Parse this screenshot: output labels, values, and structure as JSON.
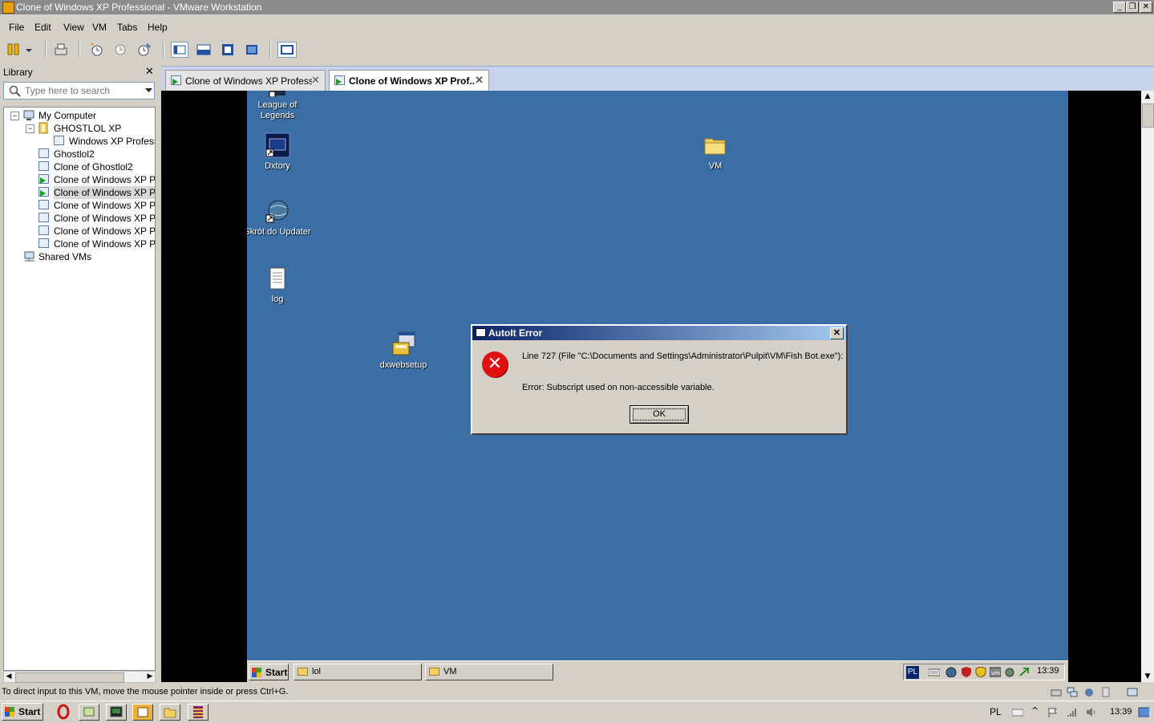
{
  "window": {
    "title": "Clone of Windows XP Professional - VMware Workstation"
  },
  "menu": [
    "File",
    "Edit",
    "View",
    "VM",
    "Tabs",
    "Help"
  ],
  "library": {
    "title": "Library",
    "search_placeholder": "Type here to search",
    "tree": [
      {
        "label": "My Computer"
      },
      {
        "label": "GHOSTLOL XP"
      },
      {
        "label": "Windows XP Professior"
      },
      {
        "label": "Ghostlol2"
      },
      {
        "label": "Clone of Ghostlol2"
      },
      {
        "label": "Clone of Windows XP Profe",
        "running": true
      },
      {
        "label": "Clone of Windows XP Profe",
        "running": true,
        "selected": true
      },
      {
        "label": "Clone of Windows XP Profe"
      },
      {
        "label": "Clone of Windows XP Profe"
      },
      {
        "label": "Clone of Windows XP Profe"
      },
      {
        "label": "Clone of Windows XP Profe"
      },
      {
        "label": "Shared VMs"
      }
    ]
  },
  "tabs": [
    {
      "label": "Clone of Windows XP Professi...",
      "active": false
    },
    {
      "label": "Clone of Windows XP Prof...",
      "active": true
    }
  ],
  "guest": {
    "desktop_icons": [
      {
        "label": "League of Legends"
      },
      {
        "label": "Dxtory"
      },
      {
        "label": "Skrót do Updater"
      },
      {
        "label": "log"
      },
      {
        "label": "dxwebsetup"
      },
      {
        "label": "VM"
      }
    ],
    "dialog": {
      "title": "AutoIt Error",
      "line1": "Line 727  (File \"C:\\Documents and Settings\\Administrator\\Pulpit\\VM\\Fish Bot.exe\"):",
      "line2": "Error: Subscript used on non-accessible variable.",
      "ok": "OK"
    },
    "taskbar": {
      "start": "Start",
      "tasks": [
        "lol",
        "VM"
      ],
      "lang": "PL",
      "clock": "13:39"
    }
  },
  "statusbar": {
    "message": "To direct input to this VM, move the mouse pointer inside or press Ctrl+G."
  },
  "host_taskbar": {
    "start": "Start",
    "lang": "PL",
    "clock": "13:39"
  },
  "colors": {
    "desktop": "#3a6ea5",
    "dialog_title": "#0a246a",
    "error": "#e01010"
  }
}
